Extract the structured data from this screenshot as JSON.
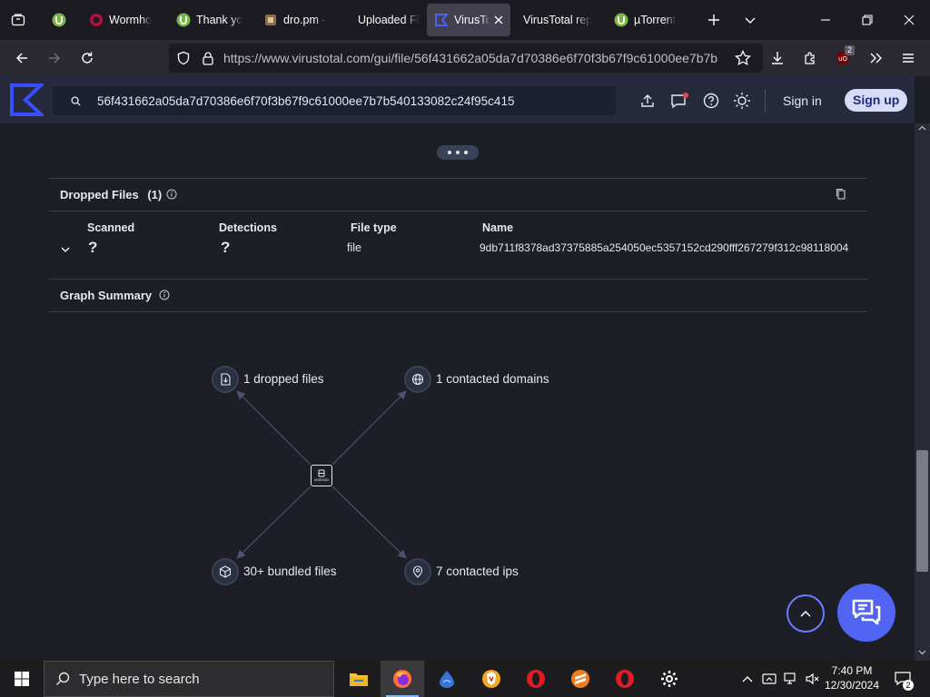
{
  "browser": {
    "tabs": [
      {
        "label": "Wormho",
        "icon": "wormhole-icon"
      },
      {
        "label": "Thank yo",
        "icon": "utorrent-icon"
      },
      {
        "label": "dro.pm -",
        "icon": "dropm-icon"
      },
      {
        "label": "Uploaded File",
        "icon": ""
      },
      {
        "label": "VirusTo",
        "icon": "virustotal-icon",
        "active": true
      },
      {
        "label": "VirusTotal rep",
        "icon": ""
      },
      {
        "label": "µTorrent",
        "icon": "utorrent-icon"
      }
    ],
    "url": "https://www.virustotal.com/gui/file/56f431662a05da7d70386e6f70f3b67f9c61000ee7b7b",
    "extension_badge": "2"
  },
  "vt": {
    "search_value": "56f431662a05da7d70386e6f70f3b67f9c61000ee7b7b540133082c24f95c415",
    "sign_in": "Sign in",
    "sign_up": "Sign up"
  },
  "dropped": {
    "title": "Dropped Files",
    "count": "(1)",
    "columns": [
      "Scanned",
      "Detections",
      "File type",
      "Name"
    ],
    "rows": [
      {
        "scanned": "?",
        "detections": "?",
        "file_type": "file",
        "name": "9db711f8378ad37375885a254050ec5357152cd290fff267279f312c98118004"
      }
    ]
  },
  "graph": {
    "title": "Graph Summary",
    "nodes": {
      "dropped": "1 dropped files",
      "domains": "1 contacted domains",
      "bundled": "30+ bundled files",
      "ips": "7 contacted ips"
    },
    "center_label": "ANDROID"
  },
  "taskbar": {
    "search_placeholder": "Type here to search",
    "time": "7:40 PM",
    "date": "12/30/2024",
    "notifications": "2"
  },
  "colors": {
    "accent": "#5164f4",
    "background": "#1e1f26",
    "header": "#262a3c"
  }
}
